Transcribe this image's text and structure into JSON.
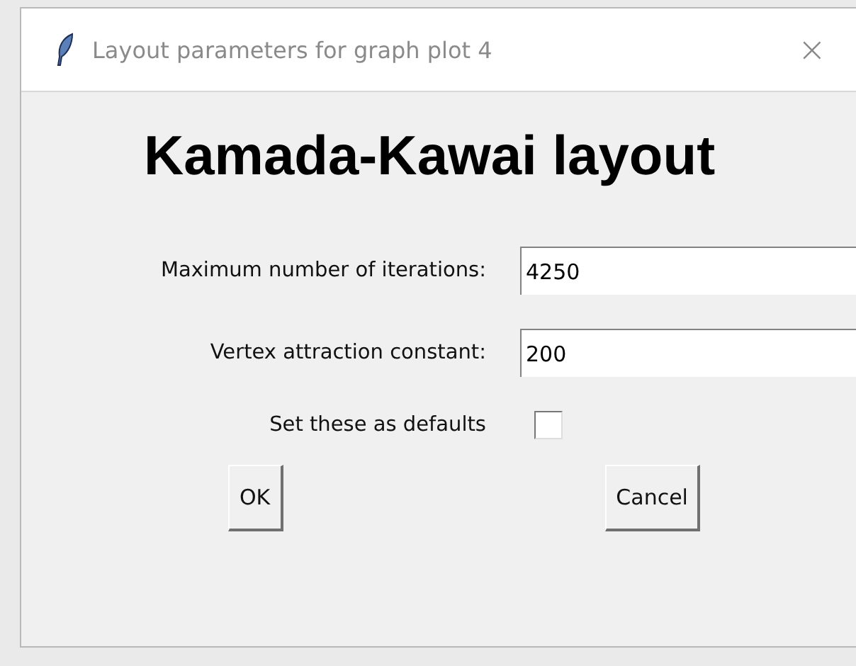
{
  "window": {
    "title": "Layout parameters for graph plot 4",
    "close": "×"
  },
  "heading": "Kamada-Kawai layout",
  "fields": [
    {
      "label": "Maximum number of iterations:",
      "value": "4250"
    },
    {
      "label": "Vertex attraction constant:",
      "value": "200"
    }
  ],
  "defaults": {
    "label": "Set these as defaults",
    "checked": false
  },
  "buttons": [
    "OK",
    "Cancel"
  ]
}
